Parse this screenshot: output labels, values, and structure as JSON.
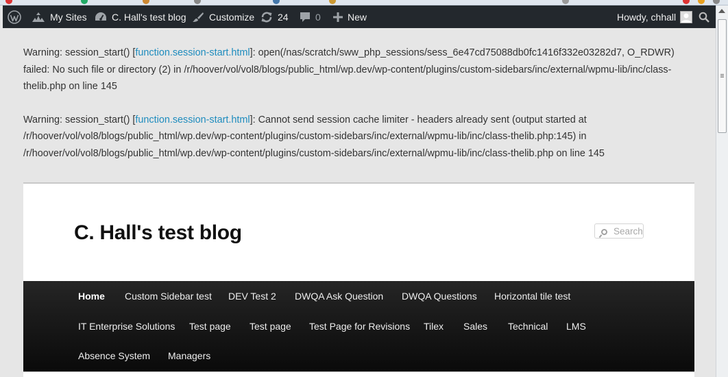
{
  "admin_bar": {
    "my_sites": "My Sites",
    "site_name": "C. Hall's test blog",
    "customize": "Customize",
    "updates_count": "24",
    "comments_count": "0",
    "new": "New",
    "howdy": "Howdy, chhall"
  },
  "warnings": [
    {
      "prefix": "Warning: session_start() [",
      "link": "function.session-start.html",
      "message": "]: open(/nas/scratch/sww_php_sessions/sess_6e47cd75088db0fc1416f332e03282d7, O_RDWR) failed: No such file or directory (2) in /r/hoover/vol/vol8/blogs/public_html/wp.dev/wp-content/plugins/custom-sidebars/inc/external/wpmu-lib/inc/class-thelib.php on line 145"
    },
    {
      "prefix": "Warning: session_start() [",
      "link": "function.session-start.html",
      "message": "]: Cannot send session cache limiter - headers already sent (output started at /r/hoover/vol/vol8/blogs/public_html/wp.dev/wp-content/plugins/custom-sidebars/inc/external/wpmu-lib/inc/class-thelib.php:145) in /r/hoover/vol/vol8/blogs/public_html/wp.dev/wp-content/plugins/custom-sidebars/inc/external/wpmu-lib/inc/class-thelib.php on line 145"
    }
  ],
  "site": {
    "title": "C. Hall's test blog",
    "search_placeholder": "Search"
  },
  "nav": {
    "items": [
      "Home",
      "Custom Sidebar test",
      "DEV Test 2",
      "DWQA Ask Question",
      "DWQA Questions",
      "Horizontal tile test",
      "IT Enterprise Solutions",
      "Test page",
      "Test page",
      "Test Page for Revisions",
      "Tilex",
      "Sales",
      "Technical",
      "LMS",
      "Absence System",
      "Managers"
    ]
  },
  "colors": {
    "admin_bar_bg": "#23282d",
    "link": "#1e8cbe",
    "nav_bg": "#111111"
  }
}
